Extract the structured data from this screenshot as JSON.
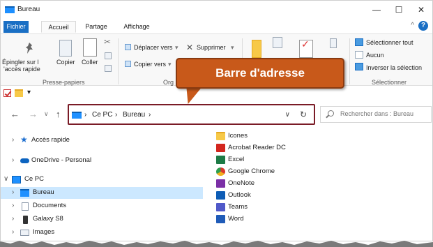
{
  "window": {
    "title": "Bureau",
    "minimize": "—",
    "maximize": "☐",
    "close": "✕"
  },
  "ribbon_tabs": [
    "Fichier",
    "Accueil",
    "Partage",
    "Affichage"
  ],
  "ribbon": {
    "pin_label_1": "Épingler sur l",
    "pin_label_2": "'accès rapide",
    "copy_label": "Copier",
    "paste_label": "Coller",
    "clipboard_group": "Presse-papiers",
    "move_to": "Déplacer vers",
    "copy_to": "Copier vers",
    "delete": "Supprimer",
    "org_group": "Org",
    "select_all": "Sélectionner tout",
    "select_none": "Aucun",
    "invert_selection": "Inverser la sélection",
    "select_group": "Sélectionner"
  },
  "callout": {
    "text": "Barre d'adresse"
  },
  "address": {
    "crumbs": [
      "›",
      "Ce PC",
      "›",
      "Bureau",
      "›"
    ],
    "search_placeholder": "Rechercher dans : Bureau"
  },
  "tree": [
    {
      "label": "Accès rapide",
      "icon": "star-icon",
      "color": "#1e6fd0"
    },
    {
      "label": "OneDrive - Personal",
      "icon": "cloud-icon",
      "color": "#0c64c0"
    },
    {
      "label": "Ce PC",
      "icon": "computer-icon",
      "color": "#1e90ff"
    },
    {
      "label": "Bureau",
      "icon": "desktop-icon",
      "color": "#1e90ff"
    },
    {
      "label": "Documents",
      "icon": "document-icon",
      "color": "#8a97a8"
    },
    {
      "label": "Galaxy S8",
      "icon": "phone-icon",
      "color": "#333333"
    },
    {
      "label": "Images",
      "icon": "image-icon",
      "color": "#8a97a8"
    }
  ],
  "files": [
    {
      "label": "Icones",
      "icon": "folder-icon",
      "color": "#f7c948"
    },
    {
      "label": "Acrobat Reader DC",
      "icon": "acrobat-icon",
      "color": "#d3261e"
    },
    {
      "label": "Excel",
      "icon": "excel-icon",
      "color": "#1d7a45"
    },
    {
      "label": "Google Chrome",
      "icon": "chrome-icon",
      "color": "#f2b01e"
    },
    {
      "label": "OneNote",
      "icon": "onenote-icon",
      "color": "#7b2fa6"
    },
    {
      "label": "Outlook",
      "icon": "outlook-icon",
      "color": "#0d5cb5"
    },
    {
      "label": "Teams",
      "icon": "teams-icon",
      "color": "#5059c9"
    },
    {
      "label": "Word",
      "icon": "word-icon",
      "color": "#1f5bb8"
    }
  ],
  "colors": {
    "accent": "#1a6fc4",
    "callout_fill": "#c8591a",
    "address_outline": "#7a1b26",
    "selection": "#cce8ff"
  }
}
